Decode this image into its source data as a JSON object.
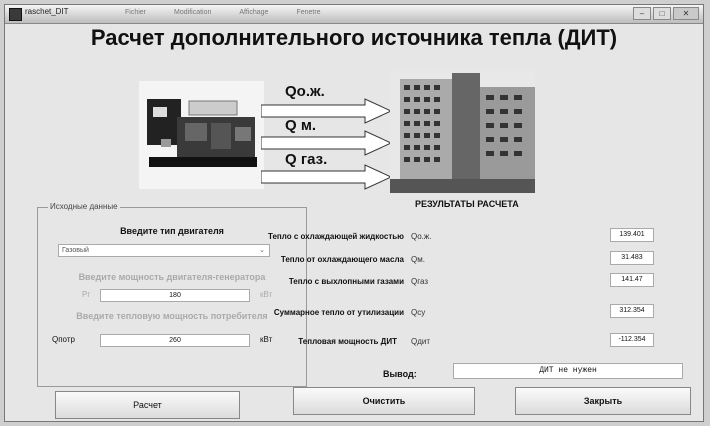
{
  "window": {
    "title": "raschet_DIT",
    "menu": [
      "Fichier",
      "Modification",
      "Affichage",
      "Fenetre"
    ]
  },
  "title": "Расчет дополнительного источника тепла (ДИТ)",
  "diagram": {
    "flows": [
      "Qо.ж.",
      "Q м.",
      "Q газ."
    ]
  },
  "input_panel": {
    "legend": "Исходные данные",
    "engine_type_heading": "Введите тип двигателя",
    "engine_type_value": "Газовый",
    "power_heading": "Введите мощность двигателя-генератора",
    "power_symbol": "Рг",
    "power_value": "180",
    "power_unit": "кВт",
    "consumer_heading": "Введите тепловую мощность потребителя",
    "consumer_symbol": "Qпотр",
    "consumer_value": "260",
    "consumer_unit": "кВт"
  },
  "results": {
    "heading": "РЕЗУЛЬТАТЫ РАСЧЕТА",
    "rows": [
      {
        "label": "Тепло с охлаждающей жидкостью",
        "symbol": "Qо.ж.",
        "value": "139.401"
      },
      {
        "label": "Тепло от охлаждающего масла",
        "symbol": "Qм.",
        "value": "31.483"
      },
      {
        "label": "Тепло с выхлопными газами",
        "symbol": "Qгаз",
        "value": "141.47"
      },
      {
        "label": "Суммарное тепло от утилизации",
        "symbol": "Qсу",
        "value": "312.354"
      },
      {
        "label": "Тепловая мощность ДИТ",
        "symbol": "Qдит",
        "value": "-112.354"
      }
    ],
    "conclusion_label": "Вывод:",
    "conclusion_value": "ДИТ не нужен"
  },
  "buttons": {
    "calculate": "Расчет",
    "clear": "Очистить",
    "close": "Закрыть"
  }
}
